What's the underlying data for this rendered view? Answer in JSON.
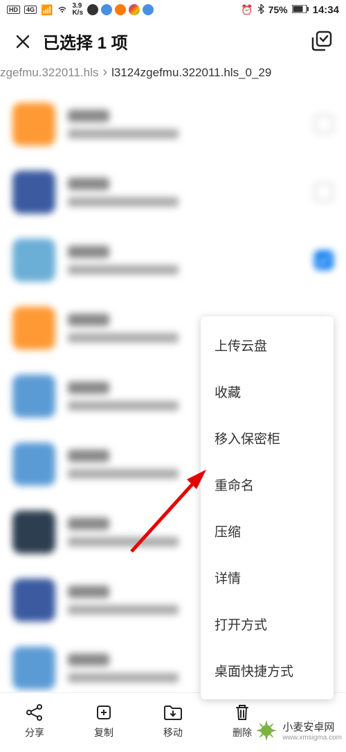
{
  "status": {
    "speed_val": "3.9",
    "speed_unit": "K/s",
    "battery": "75%",
    "time": "14:34"
  },
  "header": {
    "title": "已选择 1 项"
  },
  "breadcrumb": {
    "first": "zgefmu.322011.hls",
    "second": "l3124zgefmu.322011.hls_0_29"
  },
  "menu": {
    "items": [
      {
        "label": "上传云盘"
      },
      {
        "label": "收藏"
      },
      {
        "label": "移入保密柜"
      },
      {
        "label": "重命名"
      },
      {
        "label": "压缩"
      },
      {
        "label": "详情"
      },
      {
        "label": "打开方式"
      },
      {
        "label": "桌面快捷方式"
      }
    ]
  },
  "bottombar": {
    "share": "分享",
    "copy": "复制",
    "move": "移动",
    "delete": "删除"
  },
  "watermark": {
    "name": "小麦安卓网",
    "url": "www.xmsigma.com"
  }
}
